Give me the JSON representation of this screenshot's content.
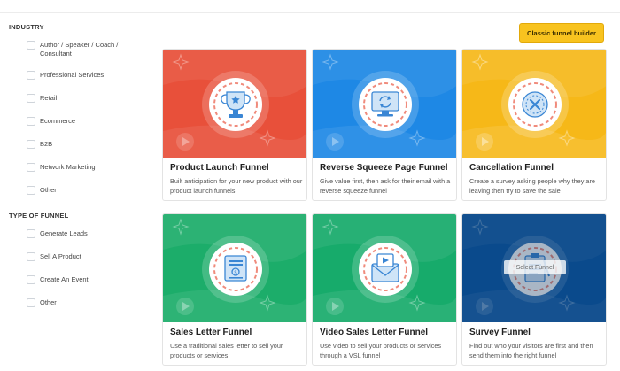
{
  "sidebar": {
    "industry_title": "INDUSTRY",
    "industry": [
      "Author / Speaker / Coach / Consultant",
      "Professional Services",
      "Retail",
      "Ecommerce",
      "B2B",
      "Network Marketing",
      "Other"
    ],
    "type_title": "TYPE OF FUNNEL",
    "types": [
      "Generate Leads",
      "Sell A Product",
      "Create An Event",
      "Other"
    ]
  },
  "toolbar": {
    "classic_label": "Classic funnel builder"
  },
  "cards": [
    {
      "title": "Product Launch Funnel",
      "desc": "Built anticipation for your new product with our product launch funnels",
      "color": "#e8503a",
      "icon": "trophy-icon"
    },
    {
      "title": "Reverse Squeeze Page Funnel",
      "desc": "Give value first, then ask for their email with a reverse squeeze funnel",
      "color": "#1e88e5",
      "icon": "monitor-refresh-icon"
    },
    {
      "title": "Cancellation Funnel",
      "desc": "Create a survey asking people why they are leaving then try to save the sale",
      "color": "#f6b818",
      "icon": "cancel-badge-icon"
    },
    {
      "title": "Sales Letter Funnel",
      "desc": "Use a traditional sales letter to sell your products or services",
      "color": "#1cad6a",
      "icon": "sales-letter-icon"
    },
    {
      "title": "Video Sales Letter Funnel",
      "desc": "Use video to sell your products or services through a VSL funnel",
      "color": "#17ab6b",
      "icon": "video-envelope-icon"
    },
    {
      "title": "Survey Funnel",
      "desc": "Find out who your visitors are first and then send them into the right funnel",
      "color": "#0b5aa8",
      "icon": "survey-clipboard-icon"
    }
  ],
  "hover": {
    "select_label": "Select Funnel"
  }
}
